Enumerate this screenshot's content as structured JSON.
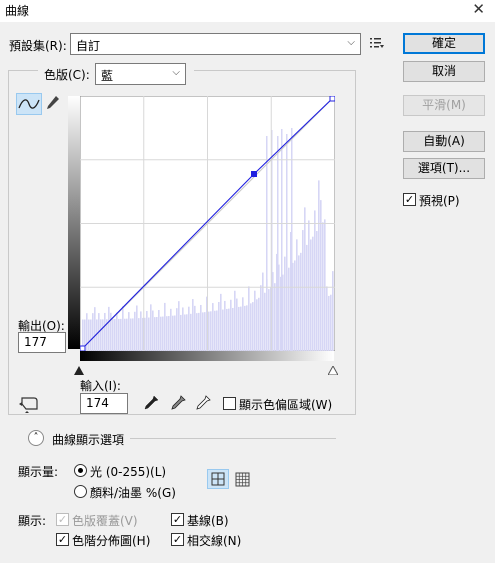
{
  "window": {
    "title": "曲線",
    "close_glyph": "✕"
  },
  "preset": {
    "label": "預設集(R):",
    "value": "自訂"
  },
  "channel": {
    "label": "色版(C):",
    "value": "藍"
  },
  "buttons": {
    "ok": "確定",
    "cancel": "取消",
    "smooth": "平滑(M)",
    "auto": "自動(A)",
    "options": "選項(T)..."
  },
  "preview": {
    "label": "預視(P)",
    "checked": true
  },
  "output": {
    "label": "輸出(O):",
    "value": "177"
  },
  "input": {
    "label": "輸入(I):",
    "value": "174"
  },
  "show_clipping": {
    "label": "顯示色偏區域(W)",
    "checked": false
  },
  "display_options": {
    "section_label": "曲線顯示選項"
  },
  "show_amount": {
    "label": "顯示量:",
    "options": [
      "光 (0-255)(L)",
      "顏料/油墨 %(G)"
    ],
    "selected": 0
  },
  "show": {
    "label": "顯示:",
    "channel_overlays": "色版覆蓋(V)",
    "baseline": "基線(B)",
    "histogram": "色階分佈圖(H)",
    "intersection_line": "相交線(N)"
  },
  "colors": {
    "curve_line": "#2020e0",
    "histogram_fill": "#d6d6f5",
    "accent_border": "#0078d7"
  },
  "icons": {
    "curve_tool": "curve-points-icon",
    "pencil_tool": "pencil-icon",
    "preset_menu": "preset-options-icon",
    "targeted_adjust": "hand-adjust-icon",
    "black_eyedropper": "eyedropper-black-icon",
    "gray_eyedropper": "eyedropper-gray-icon",
    "white_eyedropper": "eyedropper-white-icon",
    "grid_simple": "grid-4x4-icon",
    "grid_detailed": "grid-10x10-icon",
    "collapse": "chevron-up-icon"
  },
  "chart_data": {
    "type": "line",
    "x": [
      0,
      174,
      255
    ],
    "y": [
      0,
      177,
      255
    ],
    "xlim": [
      0,
      255
    ],
    "ylim": [
      0,
      255
    ],
    "control_points": [
      [
        0,
        0
      ],
      [
        174,
        177
      ],
      [
        255,
        255
      ]
    ]
  }
}
